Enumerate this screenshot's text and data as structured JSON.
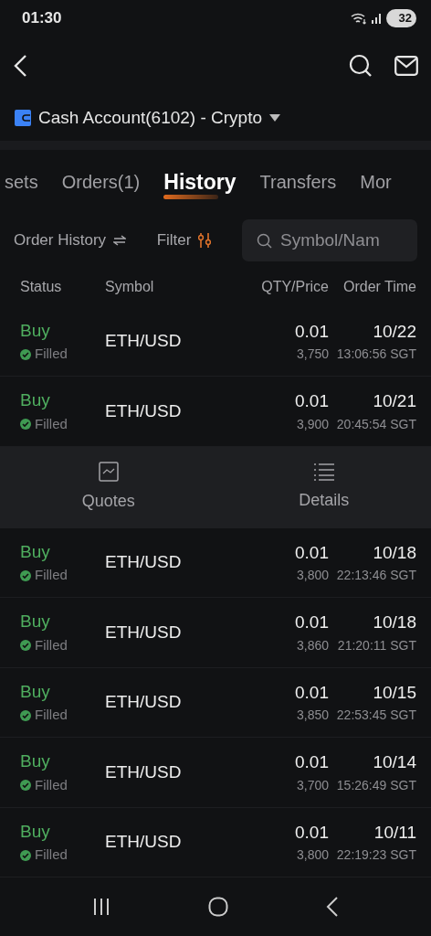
{
  "status_bar": {
    "time": "01:30",
    "battery": "32"
  },
  "account": {
    "title": "Cash Account(6102) - Crypto"
  },
  "tabs": [
    {
      "label": "sets",
      "selected": false
    },
    {
      "label": "Orders(1)",
      "selected": false
    },
    {
      "label": "History",
      "selected": true
    },
    {
      "label": "Transfers",
      "selected": false
    },
    {
      "label": "Mor",
      "selected": false
    }
  ],
  "toolbar": {
    "order_type": "Order History",
    "filter": "Filter",
    "search": {
      "placeholder": "Symbol/Nam"
    }
  },
  "table": {
    "columns": [
      "Status",
      "Symbol",
      "QTY/Price",
      "Order Time"
    ],
    "rows": [
      {
        "kind": "order",
        "side": "Buy",
        "status": "Filled",
        "symbol": "ETH/USD",
        "qty": "0.01",
        "price": "3,750",
        "date": "10/22",
        "time": "13:06:56 SGT"
      },
      {
        "kind": "order",
        "side": "Buy",
        "status": "Filled",
        "symbol": "ETH/USD",
        "qty": "0.01",
        "price": "3,900",
        "date": "10/21",
        "time": "20:45:54 SGT"
      },
      {
        "kind": "actions",
        "actions": [
          {
            "kind": "chart",
            "label": "Quotes"
          },
          {
            "kind": "list",
            "label": "Details"
          }
        ]
      },
      {
        "kind": "order",
        "side": "Buy",
        "status": "Filled",
        "symbol": "ETH/USD",
        "qty": "0.01",
        "price": "3,800",
        "date": "10/18",
        "time": "22:13:46 SGT"
      },
      {
        "kind": "order",
        "side": "Buy",
        "status": "Filled",
        "symbol": "ETH/USD",
        "qty": "0.01",
        "price": "3,860",
        "date": "10/18",
        "time": "21:20:11 SGT"
      },
      {
        "kind": "order",
        "side": "Buy",
        "status": "Filled",
        "symbol": "ETH/USD",
        "qty": "0.01",
        "price": "3,850",
        "date": "10/15",
        "time": "22:53:45 SGT"
      },
      {
        "kind": "order",
        "side": "Buy",
        "status": "Filled",
        "symbol": "ETH/USD",
        "qty": "0.01",
        "price": "3,700",
        "date": "10/14",
        "time": "15:26:49 SGT"
      },
      {
        "kind": "order",
        "side": "Buy",
        "status": "Filled",
        "symbol": "ETH/USD",
        "qty": "0.01",
        "price": "3,800",
        "date": "10/11",
        "time": "22:19:23 SGT"
      }
    ]
  }
}
